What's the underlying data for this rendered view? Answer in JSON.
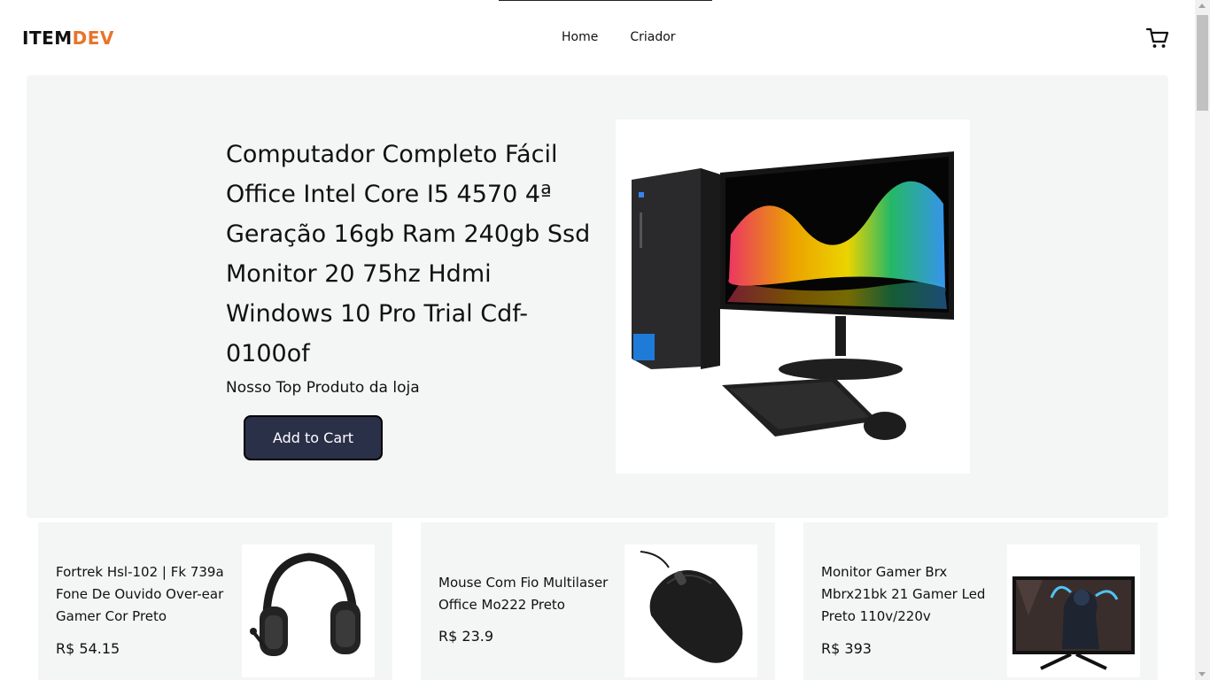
{
  "brand": {
    "part1": "ITEM",
    "part2": "DEV",
    "color1": "#111111",
    "color2": "#e8742a"
  },
  "nav": {
    "home": "Home",
    "creator": "Criador"
  },
  "cart": {
    "icon": "cart-icon"
  },
  "hero": {
    "title": "Computador Completo Fácil Office Intel Core I5 4570 4ª Geração 16gb Ram 240gb Ssd Monitor 20 75hz Hdmi Windows 10 Pro Trial Cdf-0100of",
    "subtitle": "Nosso Top Produto da loja",
    "button_label": "Add to Cart",
    "button_color": "#2b3049"
  },
  "products": [
    {
      "title": "Fortrek Hsl-102 | Fk 739a Fone De Ouvido Over-ear Gamer Cor Preto",
      "price": "R$ 54.15",
      "image": "headset-image"
    },
    {
      "title": "Mouse Com Fio Multilaser Office Mo222 Preto",
      "price": "R$ 23.9",
      "image": "mouse-image"
    },
    {
      "title": "Monitor Gamer Brx Mbrx21bk 21 Gamer Led Preto 110v/220v",
      "price": "R$ 393",
      "image": "monitor-image"
    }
  ]
}
